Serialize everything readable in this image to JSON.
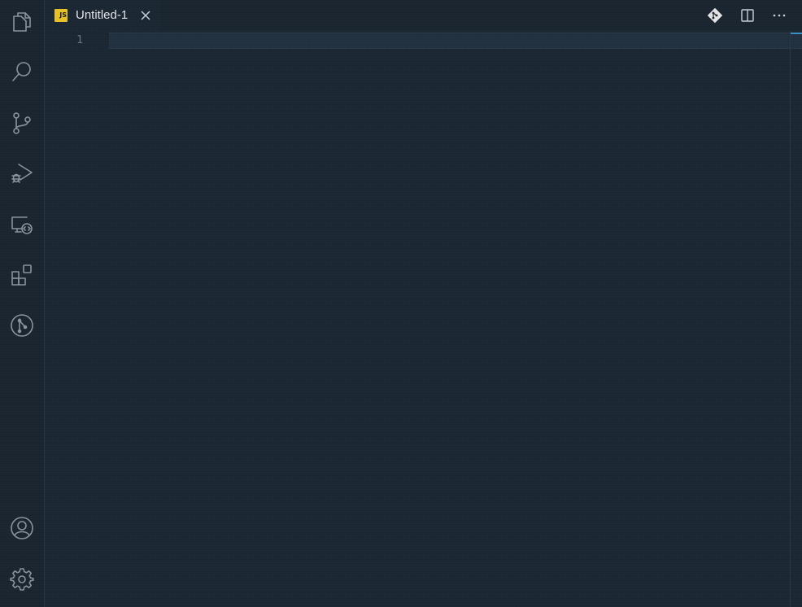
{
  "activity_bar": {
    "top_items": [
      {
        "id": "explorer",
        "icon": "files-icon"
      },
      {
        "id": "search",
        "icon": "search-icon"
      },
      {
        "id": "source-control",
        "icon": "source-control-icon"
      },
      {
        "id": "run-debug",
        "icon": "run-debug-icon"
      },
      {
        "id": "remote-explorer",
        "icon": "remote-explorer-icon"
      },
      {
        "id": "extensions",
        "icon": "extensions-icon"
      },
      {
        "id": "git-graph",
        "icon": "git-graph-icon"
      }
    ],
    "bottom_items": [
      {
        "id": "accounts",
        "icon": "account-icon"
      },
      {
        "id": "manage",
        "icon": "gear-icon"
      }
    ]
  },
  "tabs": [
    {
      "title": "Untitled-1",
      "language_badge": "JS",
      "badge_color": "#e8c227",
      "active": true
    }
  ],
  "tab_actions": [
    {
      "id": "git",
      "icon": "git-icon"
    },
    {
      "id": "split-editor",
      "icon": "split-editor-icon"
    },
    {
      "id": "more",
      "icon": "more-icon",
      "label": "···"
    }
  ],
  "editor": {
    "line_numbers": [
      "1"
    ],
    "lines": [
      ""
    ]
  },
  "colors": {
    "background": "#1b2733",
    "accent": "#3a90c8",
    "js_badge": "#e8c227"
  }
}
